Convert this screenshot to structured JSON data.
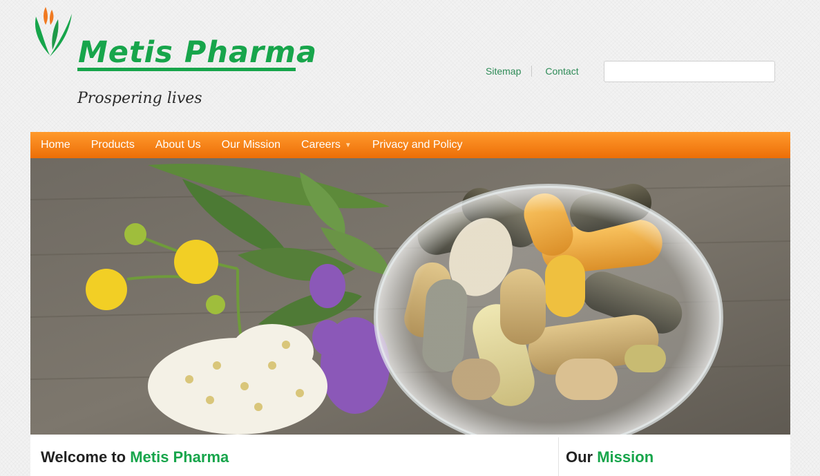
{
  "header": {
    "brand_name": "Metis Pharma",
    "tagline": "Prospering lives",
    "logo_icon": "leaf-logo-icon",
    "top_links": [
      "Sitemap",
      "Contact"
    ],
    "search": {
      "value": "",
      "placeholder": ""
    }
  },
  "nav": {
    "items": [
      "Home",
      "Products",
      "About Us",
      "Our Mission",
      "Careers",
      "Privacy and Policy"
    ],
    "has_dropdown": [
      false,
      false,
      false,
      false,
      true,
      false
    ]
  },
  "banner": {
    "description_icon": "herbal-capsules-bowl-image"
  },
  "content": {
    "welcome_prefix": "Welcome to ",
    "welcome_accent": "Metis Pharma",
    "mission_prefix": "Our ",
    "mission_accent": "Mission"
  },
  "colors": {
    "brand_green": "#17a54b",
    "nav_orange": "#f7861c",
    "link_green": "#2e8b57"
  }
}
